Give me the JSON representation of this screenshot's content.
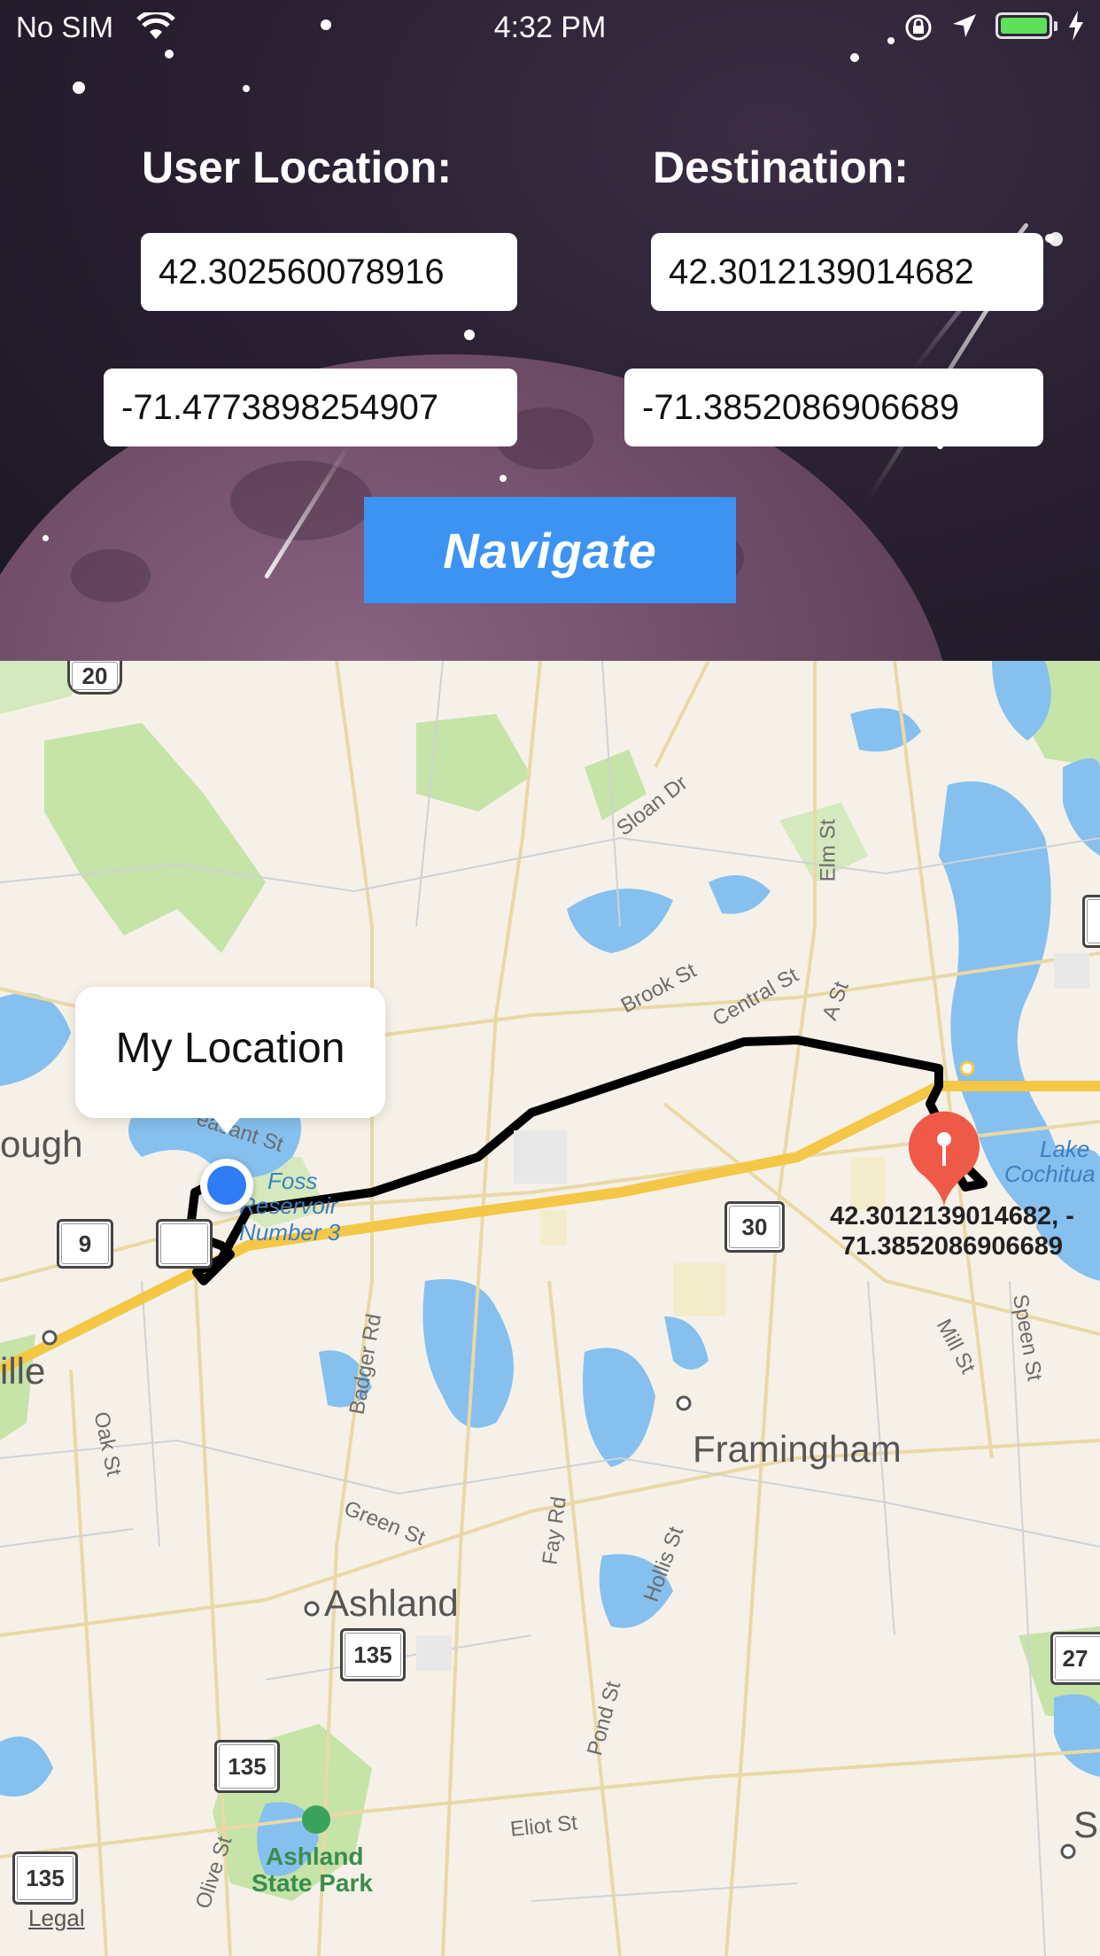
{
  "status_bar": {
    "carrier": "No SIM",
    "time": "4:32 PM",
    "battery_color": "#5ee05a"
  },
  "form": {
    "user_location_label": "User Location:",
    "destination_label": "Destination:",
    "user_latitude": "42.302560078916",
    "user_longitude": "-71.4773898254907",
    "destination_latitude": "42.3012139014682",
    "destination_longitude": "-71.3852086906689",
    "navigate_label": "Navigate",
    "navigate_color": "#3d93f2"
  },
  "map": {
    "callout_title": "My Location",
    "destination_pin_label_line1": "42.3012139014682, -",
    "destination_pin_label_line2": "71.3852086906689",
    "legal_label": "Legal",
    "places": {
      "framingham": "Framingham",
      "ashland": "Ashland",
      "ashland_state_park_1": "Ashland",
      "ashland_state_park_2": "State Park",
      "lake_cochituate_1": "Lake",
      "lake_cochituate_2": "Cochitua",
      "foss_reservoir_1": "Foss",
      "foss_reservoir_2": "Reservoir",
      "foss_reservoir_3": "Number 3",
      "ough": "ough",
      "ille": "ille",
      "s_edge": "S"
    },
    "roads": {
      "sloan_dr": "Sloan Dr",
      "elm_st": "Elm St",
      "brook_st": "Brook St",
      "central_st": "Central St",
      "a_st": "A St",
      "pleasant_st": "easant St",
      "badger_rd": "Badger Rd",
      "oak_st": "Oak St",
      "green_st": "Green St",
      "fay_rd": "Fay Rd",
      "hollis_st": "Hollis St",
      "pond_st": "Pond St",
      "eliot_st": "Eliot St",
      "olive_st": "Olive St",
      "mill_st": "Mill St",
      "speen_st": "Speen St"
    },
    "shields": {
      "us20": "20",
      "rt9": "9",
      "rt30": "30",
      "rt135_a": "135",
      "rt135_b": "135",
      "rt135_c": "135",
      "rt27": "27"
    }
  }
}
